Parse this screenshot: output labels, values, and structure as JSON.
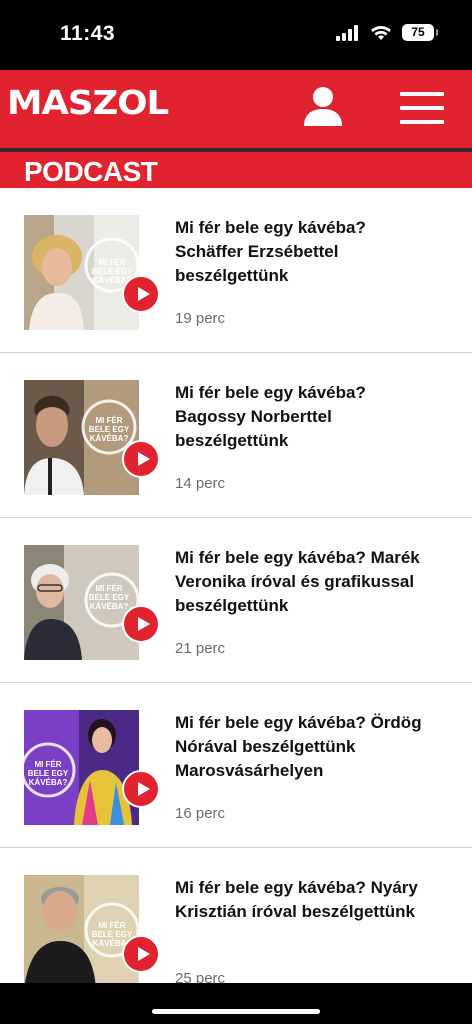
{
  "status_bar": {
    "time": "11:43",
    "battery": "75"
  },
  "header": {
    "logo": "MASZOL"
  },
  "section": {
    "title": "PODCAST"
  },
  "podcasts": [
    {
      "title": "Mi fér bele egy kávéba? Schäffer Erzsébettel beszélgettünk",
      "duration": "19 perc",
      "thumb_caption": "MI FÉR BELE EGY KÁVÉBA?"
    },
    {
      "title": "Mi fér bele egy kávéba? Bagossy Norberttel beszélgettünk",
      "duration": "14 perc",
      "thumb_caption": "MI FÉR BELE EGY KÁVÉBA?"
    },
    {
      "title": "Mi fér bele egy kávéba? Marék Veronika íróval és grafikussal beszélgettünk",
      "duration": "21 perc",
      "thumb_caption": "MI FÉR BELE EGY KÁVÉBA?"
    },
    {
      "title": "Mi fér bele egy kávéba? Ördög Nórával beszélgettünk Marosvásárhelyen",
      "duration": "16 perc",
      "thumb_caption": "MI FÉR BELE EGY KÁVÉBA?"
    },
    {
      "title": "Mi fér bele egy kávéba? Nyáry Krisztián íróval beszélgettünk",
      "duration": "25 perc",
      "thumb_caption": "MI FÉR BELE EGY KÁVÉBA?"
    }
  ],
  "colors": {
    "brand_red": "#e1232f",
    "text": "#111111",
    "muted": "#6b6b6b"
  }
}
